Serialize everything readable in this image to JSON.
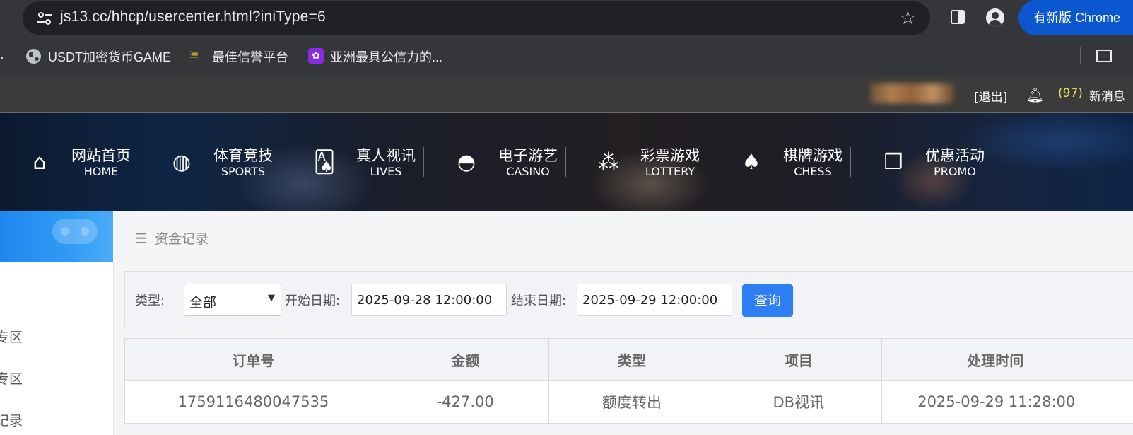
{
  "browser": {
    "url": "js13.cc/hhcp/usercenter.html?iniType=6",
    "update_label": "有新版 Chrome"
  },
  "bookmarks": {
    "leading_fragment": ".",
    "items": [
      {
        "label": "USDT加密货币GAME",
        "icon": "globe-icon"
      },
      {
        "label": "最佳信誉平台",
        "icon": "favicon-gold"
      },
      {
        "label": "亚洲最具公信力的...",
        "icon": "favicon-purple"
      }
    ]
  },
  "topbar": {
    "logout": "[退出]",
    "message_count": "(97)",
    "message_label": "新消息"
  },
  "nav": {
    "items": [
      {
        "cn": "网站首页",
        "en": "HOME",
        "icon": "home-icon",
        "glyph": "⌂"
      },
      {
        "cn": "体育竞技",
        "en": "SPORTS",
        "icon": "ball-icon",
        "glyph": "◍"
      },
      {
        "cn": "真人视讯",
        "en": "LIVES",
        "icon": "cards-icon",
        "glyph": "🂡"
      },
      {
        "cn": "电子游艺",
        "en": "CASINO",
        "icon": "roulette-icon",
        "glyph": "◓"
      },
      {
        "cn": "彩票游戏",
        "en": "LOTTERY",
        "icon": "lottery-balls-icon",
        "glyph": "⁂"
      },
      {
        "cn": "棋牌游戏",
        "en": "CHESS",
        "icon": "spade-icon",
        "glyph": "♠"
      },
      {
        "cn": "优惠活动",
        "en": "PROMO",
        "icon": "gift-icon",
        "glyph": "❒"
      }
    ]
  },
  "sidebar": {
    "items": [
      "专区",
      "专区",
      "记录"
    ]
  },
  "breadcrumb": {
    "menu_glyph": "☰",
    "title": "资金记录"
  },
  "filter": {
    "type_label": "类型:",
    "type_value": "全部",
    "start_label": "开始日期:",
    "start_value": "2025-09-28 12:00:00",
    "end_label": "结束日期:",
    "end_value": "2025-09-29 12:00:00",
    "query_label": "查询"
  },
  "table": {
    "headers": [
      "订单号",
      "金额",
      "类型",
      "项目",
      "处理时间"
    ],
    "rows": [
      [
        "1759116480047535",
        "-427.00",
        "额度转出",
        "DB视讯",
        "2025-09-29 11:28:00"
      ]
    ]
  }
}
